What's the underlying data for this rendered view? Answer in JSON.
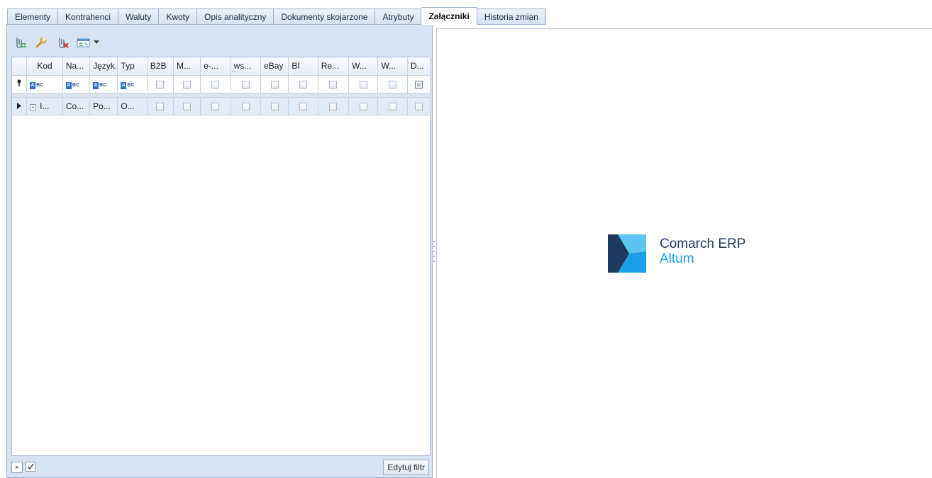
{
  "tabs": [
    {
      "label": "Elementy",
      "active": false
    },
    {
      "label": "Kontrahenci",
      "active": false
    },
    {
      "label": "Waluty",
      "active": false
    },
    {
      "label": "Kwoty",
      "active": false
    },
    {
      "label": "Opis analityczny",
      "active": false
    },
    {
      "label": "Dokumenty skojarzone",
      "active": false
    },
    {
      "label": "Atrybuty",
      "active": false
    },
    {
      "label": "Załączniki",
      "active": true
    },
    {
      "label": "Historia zmian",
      "active": false
    }
  ],
  "toolbar": {
    "icons": [
      "add-attachment-icon",
      "edit-wrench-icon",
      "delete-attachment-icon",
      "view-options-icon",
      "chevron-down-icon"
    ]
  },
  "grid": {
    "columns": [
      "Kod",
      "Na...",
      "Język...",
      "Typ",
      "B2B",
      "M...",
      "e-...",
      "ws...",
      "eBay",
      "BI",
      "Re...",
      "W...",
      "W...",
      "D..."
    ],
    "filter_text_marker": "BC",
    "filter_text_marker_first": "A",
    "rows": [
      {
        "kod": "I...",
        "nazwa": "Co...",
        "jezyk": "Po...",
        "typ": "O..."
      }
    ]
  },
  "bottom": {
    "clear_label": "×",
    "edit_filter_label": "Edytuj filtr"
  },
  "preview": {
    "logo_line1": "Comarch ERP",
    "logo_line2": "Altum"
  },
  "colors": {
    "panel_bg": "#d7e3f1",
    "logo_dark": "#1e3a5f",
    "logo_accent": "#1aa0e8"
  }
}
